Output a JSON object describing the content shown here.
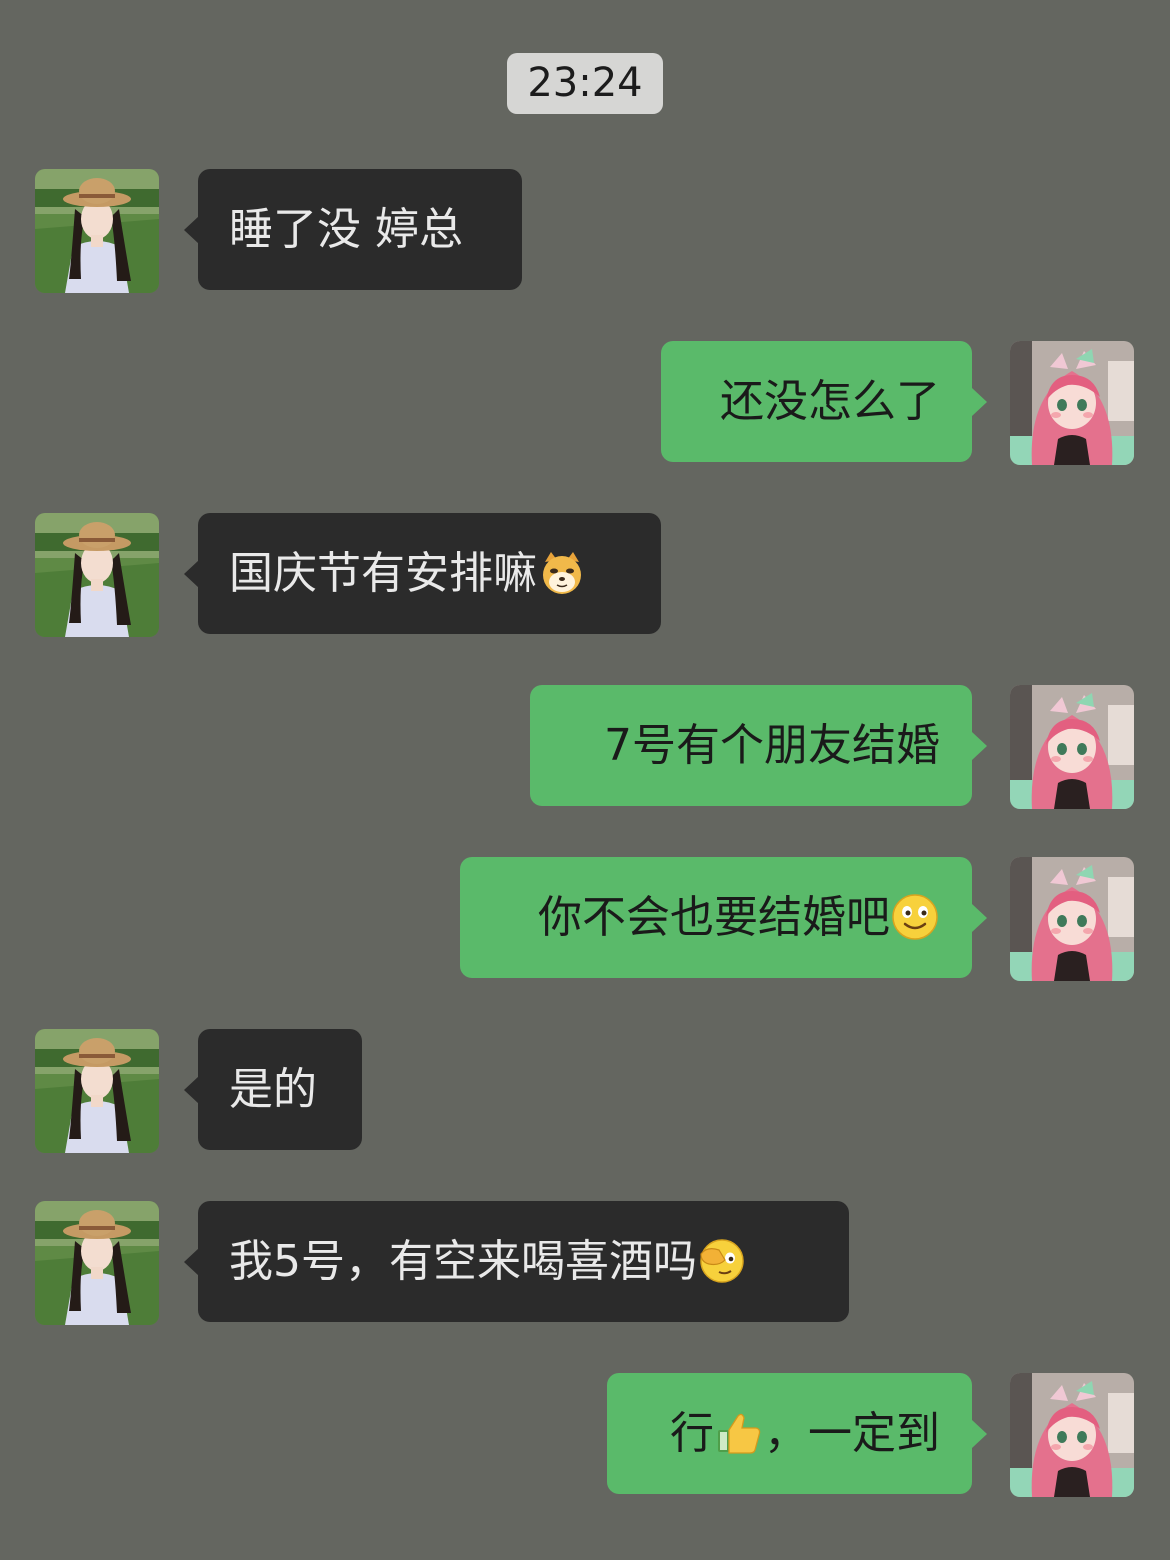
{
  "chat": {
    "timestamp": "23:24",
    "messages": [
      {
        "side": "in",
        "text": "睡了没 婷总"
      },
      {
        "side": "out",
        "text": "还没怎么了"
      },
      {
        "side": "in",
        "text": "国庆节有安排嘛",
        "emoji": "doge-emoji"
      },
      {
        "side": "out",
        "text": "7号有个朋友结婚"
      },
      {
        "side": "out",
        "text": "你不会也要结婚吧",
        "emoji": "smile-emoji"
      },
      {
        "side": "in",
        "text": "是的"
      },
      {
        "side": "in",
        "text": "我5号，有空来喝喜酒吗",
        "emoji": "facepalm-emoji"
      },
      {
        "side": "out",
        "text_before": "行",
        "emoji": "thumbs-up-emoji",
        "text_after": "，一定到"
      }
    ]
  },
  "colors": {
    "background": "#646660",
    "incoming_bubble": "#2b2b2b",
    "outgoing_bubble": "#5aba6a",
    "timestamp_bg": "#d6d6d4"
  }
}
